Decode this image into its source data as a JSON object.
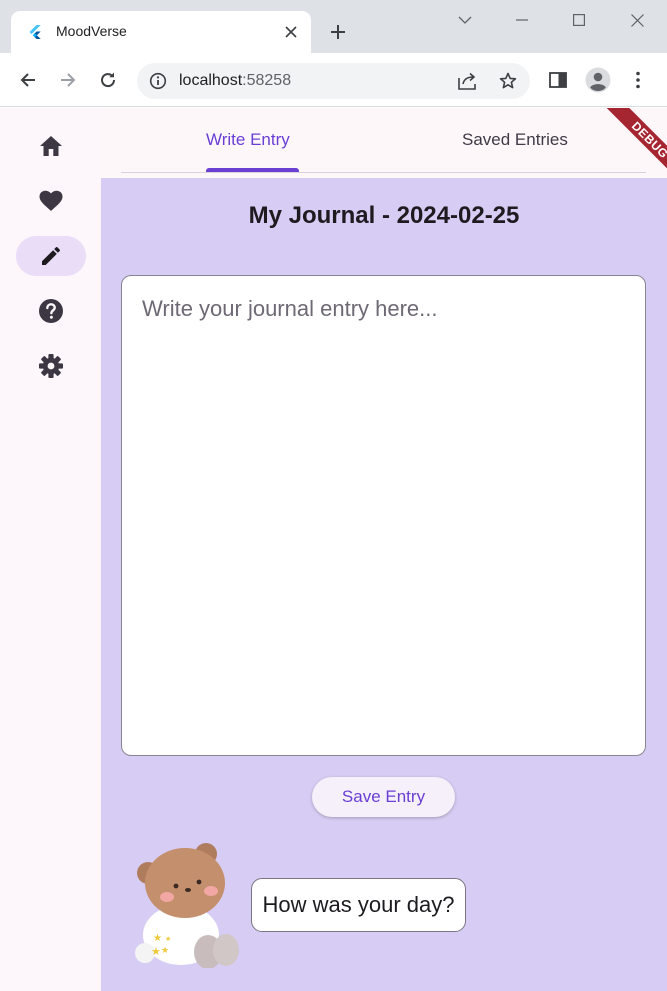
{
  "browser": {
    "tab_title": "MoodVerse",
    "url_host": "localhost",
    "url_port": ":58258"
  },
  "rail": {
    "items": [
      {
        "icon": "home-icon",
        "active": false
      },
      {
        "icon": "heart-icon",
        "active": false
      },
      {
        "icon": "edit-icon",
        "active": true
      },
      {
        "icon": "help-icon",
        "active": false
      },
      {
        "icon": "settings-icon",
        "active": false
      }
    ]
  },
  "tabs": {
    "write_label": "Write Entry",
    "saved_label": "Saved Entries",
    "active": "write"
  },
  "debug_banner": "DEBUG",
  "journal": {
    "title": "My Journal - 2024-02-25",
    "placeholder": "Write your journal entry here...",
    "value": "",
    "save_label": "Save Entry"
  },
  "mascot": {
    "prompt": "How was your day?"
  },
  "colors": {
    "accent": "#6a3fd4",
    "content_bg": "#d7cdf4",
    "rail_active": "#e9ddf7",
    "debug_banner": "#a52531"
  }
}
